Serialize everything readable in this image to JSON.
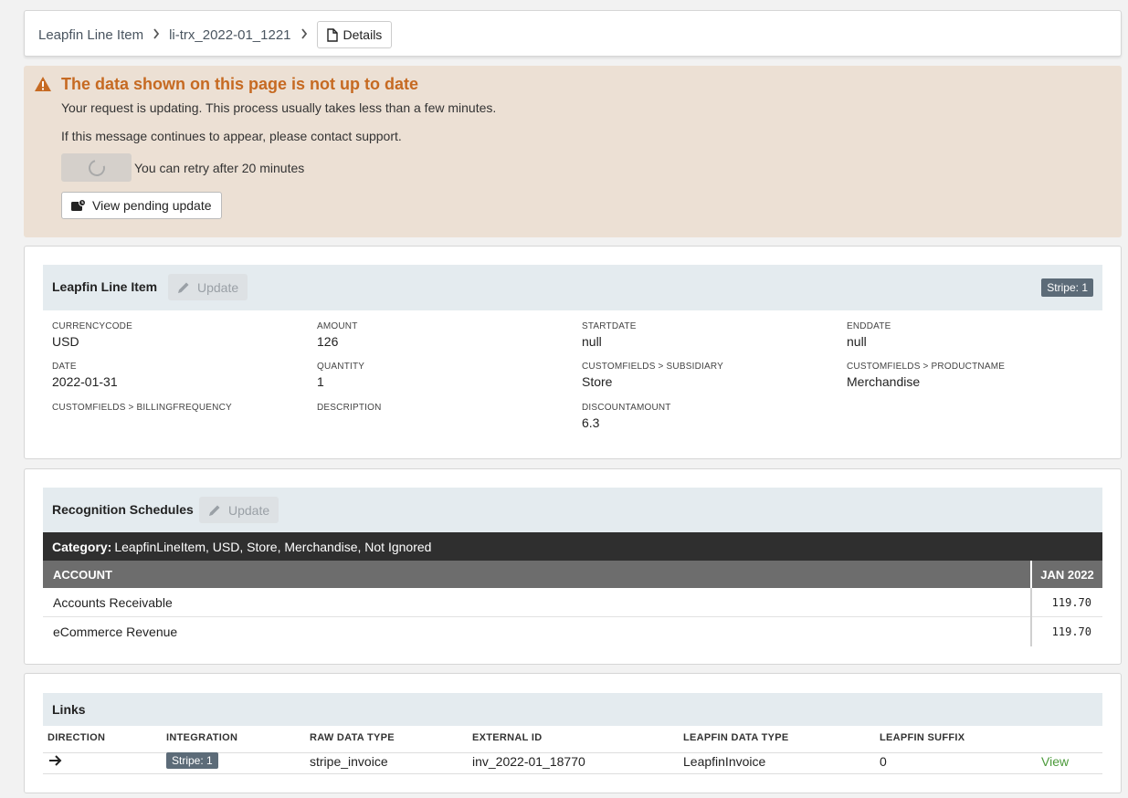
{
  "breadcrumb": {
    "root": "Leapfin Line Item",
    "item": "li-trx_2022-01_1221",
    "details_label": "Details"
  },
  "warning": {
    "title": "The data shown on this page is not up to date",
    "line1": "Your request is updating. This process usually takes less than a few minutes.",
    "line2": "If this message continues to appear, please contact support.",
    "retry_text": "You can retry after 20 minutes",
    "pending_label": "View pending update",
    "accent_color": "#c66a22"
  },
  "line_item": {
    "title": "Leapfin Line Item",
    "update_label": "Update",
    "badge": "Stripe: 1",
    "fields": [
      {
        "label": "CURRENCYCODE",
        "value": "USD"
      },
      {
        "label": "AMOUNT",
        "value": "126"
      },
      {
        "label": "STARTDATE",
        "value": "null"
      },
      {
        "label": "ENDDATE",
        "value": "null"
      },
      {
        "label": "DATE",
        "value": "2022-01-31"
      },
      {
        "label": "QUANTITY",
        "value": "1"
      },
      {
        "label": "CUSTOMFIELDS > SUBSIDIARY",
        "value": "Store"
      },
      {
        "label": "CUSTOMFIELDS > PRODUCTNAME",
        "value": "Merchandise"
      },
      {
        "label": "CUSTOMFIELDS > BILLINGFREQUENCY",
        "value": ""
      },
      {
        "label": "DESCRIPTION",
        "value": ""
      },
      {
        "label": "DISCOUNTAMOUNT",
        "value": "6.3"
      }
    ]
  },
  "recognition": {
    "title": "Recognition Schedules",
    "update_label": "Update",
    "category_label": "Category:",
    "category_value": "LeapfinLineItem, USD, Store, Merchandise, Not Ignored",
    "col_account": "ACCOUNT",
    "col_period": "JAN 2022",
    "rows": [
      {
        "account": "Accounts Receivable",
        "amount": "119.70"
      },
      {
        "account": "eCommerce Revenue",
        "amount": "119.70"
      }
    ]
  },
  "links": {
    "title": "Links",
    "headers": [
      "DIRECTION",
      "INTEGRATION",
      "RAW DATA TYPE",
      "EXTERNAL ID",
      "LEAPFIN DATA TYPE",
      "LEAPFIN SUFFIX"
    ],
    "row": {
      "direction_icon": "arrow-right-icon",
      "integration": "Stripe: 1",
      "raw_data_type": "stripe_invoice",
      "external_id": "inv_2022-01_18770",
      "leapfin_data_type": "LeapfinInvoice",
      "leapfin_suffix": "0",
      "action": "View"
    }
  }
}
